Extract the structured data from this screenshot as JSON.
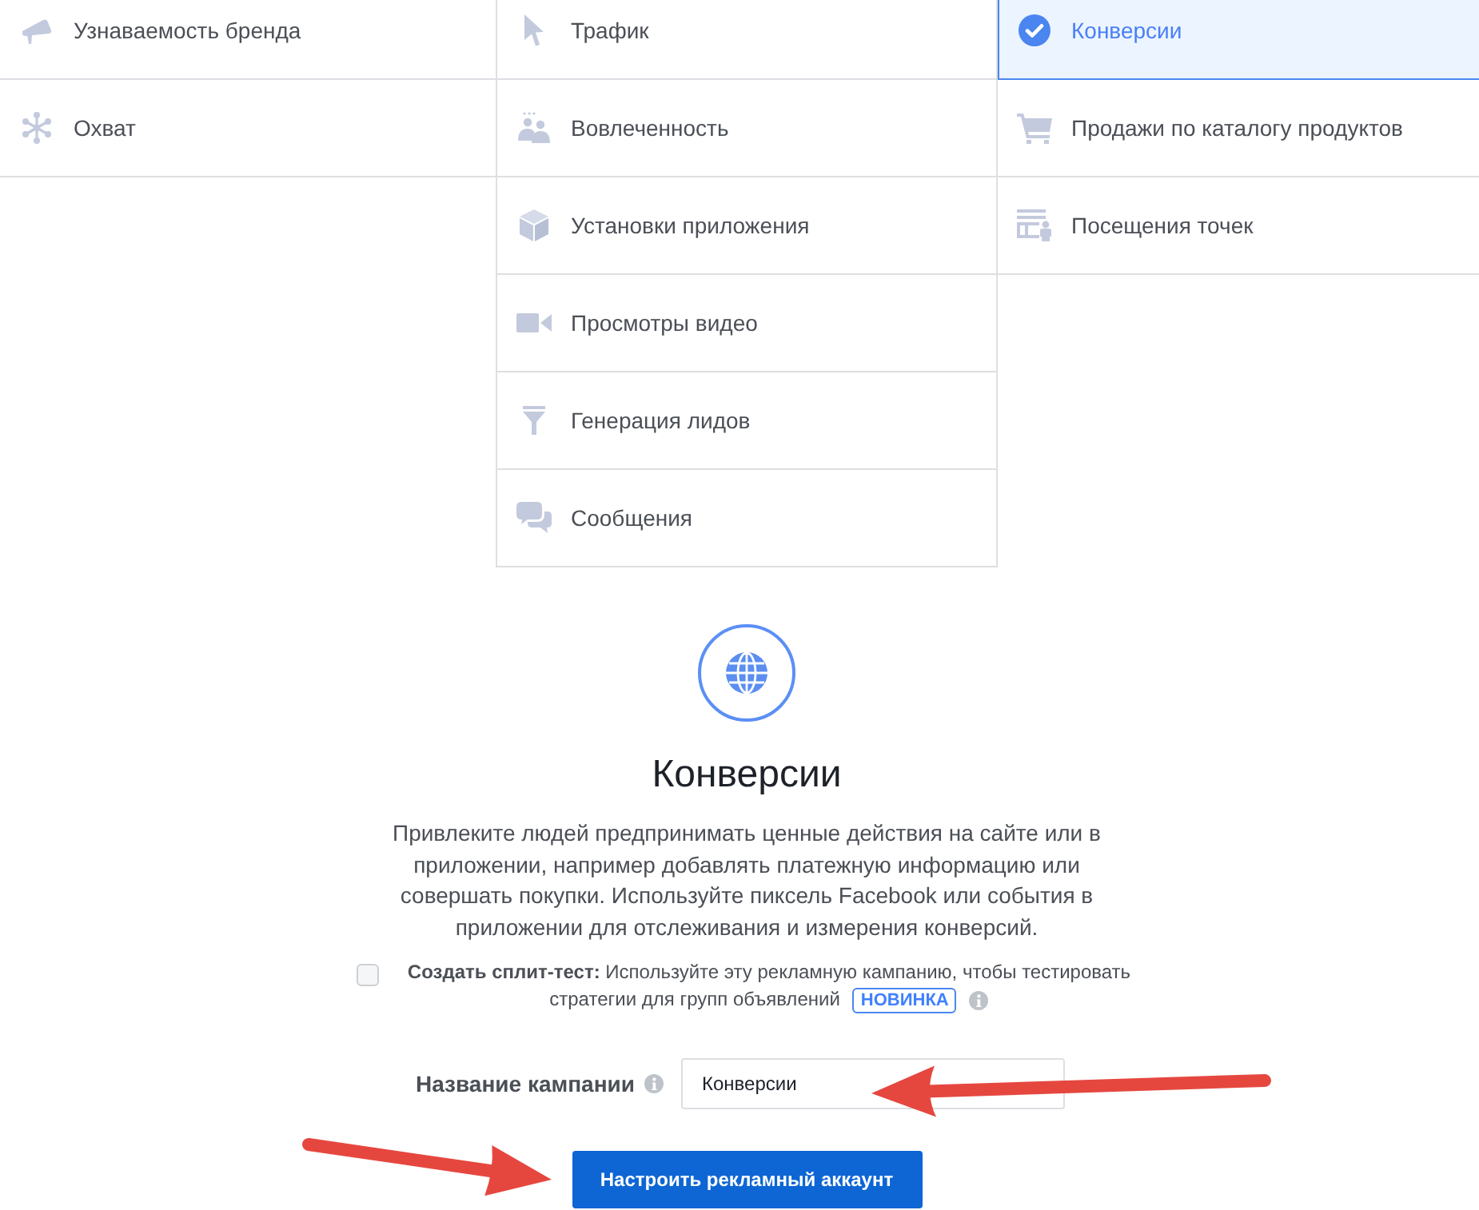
{
  "objectives": {
    "columns": [
      {
        "items": [
          {
            "label": "Узнаваемость бренда",
            "selected": false
          },
          {
            "label": "Охват",
            "selected": false
          }
        ]
      },
      {
        "items": [
          {
            "label": "Трафик",
            "selected": false
          },
          {
            "label": "Вовлеченность",
            "selected": false
          },
          {
            "label": "Установки приложения",
            "selected": false
          },
          {
            "label": "Просмотры видео",
            "selected": false
          },
          {
            "label": "Генерация лидов",
            "selected": false
          },
          {
            "label": "Сообщения",
            "selected": false
          }
        ]
      },
      {
        "items": [
          {
            "label": "Конверсии",
            "selected": true
          },
          {
            "label": "Продажи по каталогу продуктов",
            "selected": false
          },
          {
            "label": "Посещения точек",
            "selected": false
          }
        ]
      }
    ]
  },
  "detail": {
    "title": "Конверсии",
    "description": "Привлеките людей предпринимать ценные действия на сайте или в приложении, например добавлять платежную информацию или совершать покупки. Используйте пиксель Facebook или события в приложении для отслеживания и измерения конверсий.",
    "split_test": {
      "checked": false,
      "text": "**Создать сплит-тест:** Используйте эту рекламную кампанию, чтобы тестировать стратегии для групп объявлений",
      "badge": "НОВИНКА"
    },
    "campaign_name": {
      "label": "Название кампании",
      "value": "Конверсии",
      "annotated": true
    },
    "submit_button": {
      "label": "Настроить рекламный аккаунт",
      "annotated": true
    }
  }
}
